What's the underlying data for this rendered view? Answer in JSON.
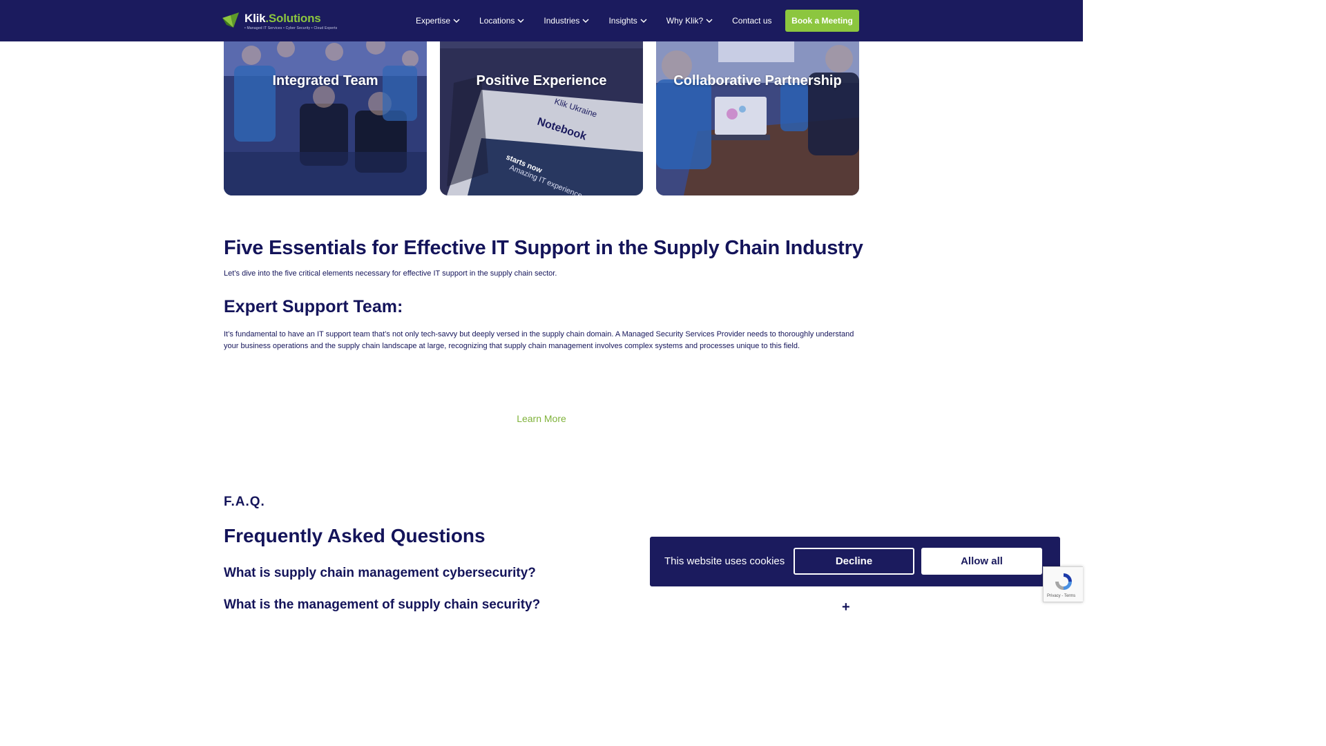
{
  "header": {
    "logo": {
      "brand": "Klik",
      "brand_suffix": ".Solutions",
      "tagline": "• Managed IT Services • Cyber Security • Cloud Experts"
    },
    "nav": [
      {
        "label": "Expertise",
        "has_dropdown": true
      },
      {
        "label": "Locations",
        "has_dropdown": true
      },
      {
        "label": "Industries",
        "has_dropdown": true
      },
      {
        "label": "Insights",
        "has_dropdown": true
      },
      {
        "label": "Why Klik?",
        "has_dropdown": true
      },
      {
        "label": "Contact us",
        "has_dropdown": false
      }
    ],
    "cta_label": "Book a Meeting"
  },
  "cards": [
    {
      "title": "Integrated Team",
      "icon": "team-photo"
    },
    {
      "title": "Positive Experience",
      "icon": "notebook-photo"
    },
    {
      "title": "Collaborative Partnership",
      "icon": "meeting-photo"
    }
  ],
  "article": {
    "title": "Five Essentials for Effective IT Support in the Supply Chain Industry",
    "intro": "Let’s dive into the five critical elements necessary for effective IT support in the supply chain sector.",
    "section_title": "Expert Support Team:",
    "section_body": "It’s fundamental to have an IT support team that’s not only tech-savvy but deeply versed in the supply chain domain. A Managed Security Services Provider needs to thoroughly understand your business operations and the supply chain landscape at large, recognizing that supply chain management involves complex systems and processes unique to this field.",
    "learn_more": "Learn More"
  },
  "faq": {
    "eyebrow": "F.A.Q.",
    "title": "Frequently Asked Questions",
    "questions": [
      "What is supply chain management cybersecurity?",
      "What is the management of supply chain security?"
    ],
    "toggle_glyph": "+"
  },
  "cookie_banner": {
    "text": "This website uses cookies",
    "decline_label": "Decline",
    "allow_label": "Allow all"
  },
  "recaptcha": {
    "links": "Privacy - Terms"
  },
  "colors": {
    "navy": "#1b1b5e",
    "text": "#14145a",
    "accent_green": "#8cc63f",
    "link_green": "#7fb23a",
    "white": "#ffffff"
  }
}
